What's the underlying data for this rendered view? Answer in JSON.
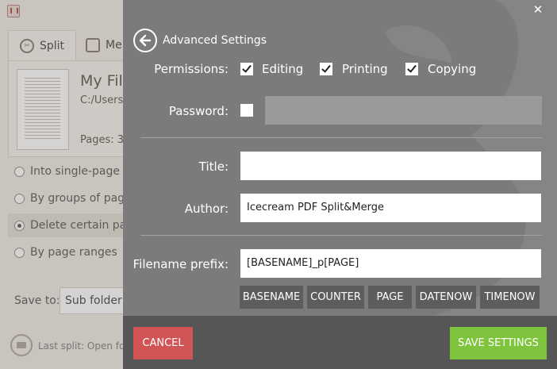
{
  "background_app": {
    "tabs": [
      {
        "label": "Split",
        "icon": "scissors-icon"
      },
      {
        "label": "Me",
        "icon": "merge-icon"
      }
    ],
    "file": {
      "name": "My File",
      "path": "C:/Users/",
      "pages": "Pages: 3"
    },
    "options": [
      {
        "label": "Into single-page f",
        "selected": false
      },
      {
        "label": "By groups of page",
        "selected": false
      },
      {
        "label": "Delete certain pa",
        "selected": true
      },
      {
        "label": "By page ranges",
        "selected": false
      }
    ],
    "save_to": {
      "label": "Save to:",
      "value": "Sub folder"
    },
    "last_split": "Last split: Open fo"
  },
  "dialog": {
    "title": "Advanced Settings",
    "close_glyph": "✕",
    "permissions": {
      "label": "Permissions:",
      "items": [
        {
          "label": "Editing",
          "checked": true
        },
        {
          "label": "Printing",
          "checked": true
        },
        {
          "label": "Copying",
          "checked": true
        }
      ]
    },
    "password": {
      "label": "Password:",
      "checked": false,
      "value": ""
    },
    "title_field": {
      "label": "Title:",
      "value": ""
    },
    "author_field": {
      "label": "Author:",
      "value": "Icecream PDF Split&Merge"
    },
    "filename_prefix": {
      "label": "Filename prefix:",
      "value": "[BASENAME]_p[PAGE]"
    },
    "tokens": [
      "BASENAME",
      "COUNTER",
      "PAGE",
      "DATENOW",
      "TIMENOW"
    ],
    "buttons": {
      "cancel": "CANCEL",
      "save": "SAVE SETTINGS"
    }
  },
  "colors": {
    "panel_bg": "#7b7b7b",
    "footer_bg": "#565656",
    "cancel": "#d25555",
    "save": "#7ec43d",
    "token_bg": "#5d5d5d"
  }
}
